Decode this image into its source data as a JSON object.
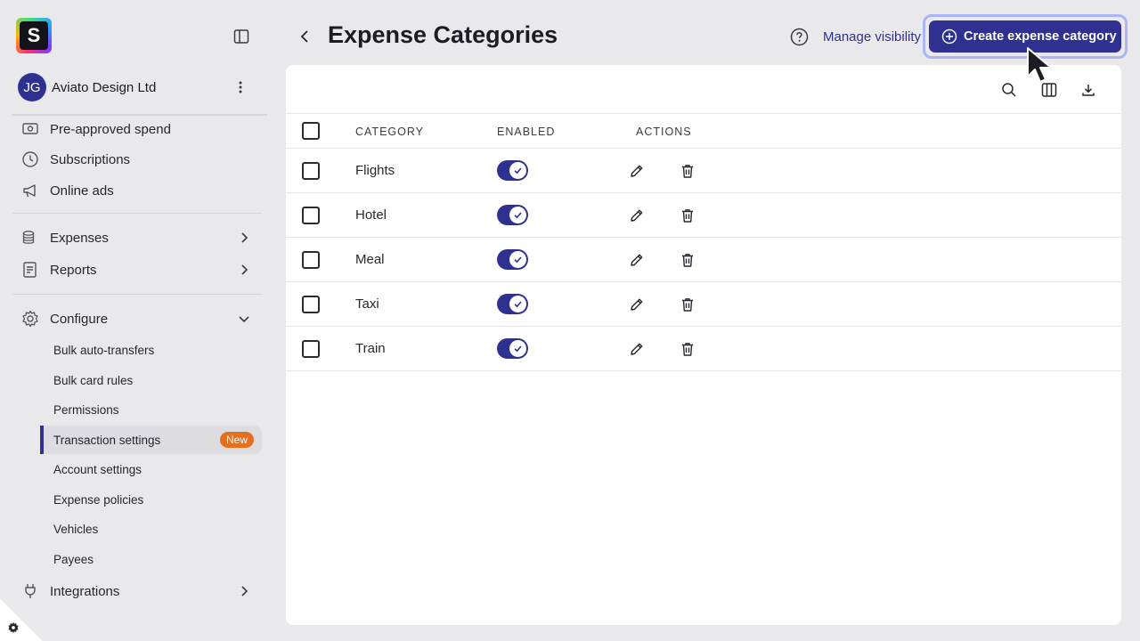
{
  "org": {
    "initials": "JG",
    "name": "Aviato Design Ltd"
  },
  "logo": {
    "letter": "S"
  },
  "nav": {
    "top_items": [
      {
        "label": "Pre-approved spend",
        "icon": "money-icon"
      },
      {
        "label": "Subscriptions",
        "icon": "clock-icon"
      },
      {
        "label": "Online ads",
        "icon": "megaphone-icon"
      }
    ],
    "groups": [
      {
        "label": "Expenses",
        "icon": "coins-icon"
      },
      {
        "label": "Reports",
        "icon": "report-icon"
      }
    ],
    "configure": {
      "label": "Configure",
      "items": [
        "Bulk auto-transfers",
        "Bulk card rules",
        "Permissions",
        "Transaction settings",
        "Account settings",
        "Expense policies",
        "Vehicles",
        "Payees"
      ],
      "active_badge": "New"
    },
    "integrations": {
      "label": "Integrations",
      "icon": "plug-icon"
    }
  },
  "header": {
    "title": "Expense Categories",
    "manage_visibility": "Manage visibility",
    "create_button": "Create expense category"
  },
  "table": {
    "columns": [
      "CATEGORY",
      "ENABLED",
      "ACTIONS"
    ],
    "rows": [
      {
        "name": "Flights",
        "enabled": true
      },
      {
        "name": "Hotel",
        "enabled": true
      },
      {
        "name": "Meal",
        "enabled": true
      },
      {
        "name": "Taxi",
        "enabled": true
      },
      {
        "name": "Train",
        "enabled": true
      }
    ]
  },
  "colors": {
    "accent": "#2f3191",
    "badge": "#e4701d",
    "background": "#e9e9ec"
  }
}
